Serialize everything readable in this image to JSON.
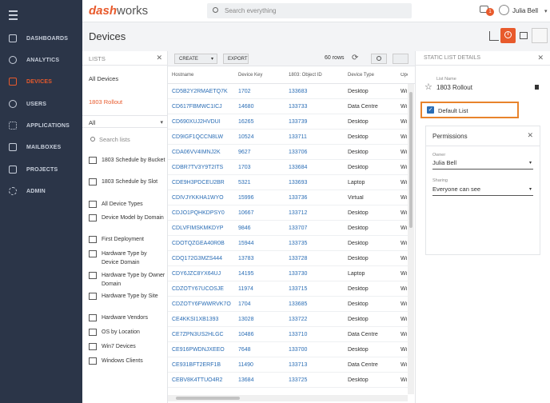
{
  "topbar": {
    "logo_part1": "dash",
    "logo_part2": "works",
    "search_placeholder": "Search everything",
    "notification_count": "1",
    "user_name": "Julia Bell"
  },
  "nav": [
    {
      "label": "DASHBOARDS",
      "icon": "dashboard-icon"
    },
    {
      "label": "ANALYTICS",
      "icon": "analytics-icon"
    },
    {
      "label": "DEVICES",
      "icon": "laptop-icon",
      "active": true
    },
    {
      "label": "USERS",
      "icon": "user-icon"
    },
    {
      "label": "APPLICATIONS",
      "icon": "grid-icon"
    },
    {
      "label": "MAILBOXES",
      "icon": "mail-icon"
    },
    {
      "label": "PROJECTS",
      "icon": "project-icon"
    },
    {
      "label": "ADMIN",
      "icon": "gear-icon"
    }
  ],
  "page": {
    "title": "Devices"
  },
  "lists_panel": {
    "header": "LISTS",
    "all_devices": "All Devices",
    "active_list": "1803 Rollout",
    "filter_value": "All",
    "search_placeholder": "Search lists",
    "entries": [
      "1803 Schedule by Bucket",
      "1803 Schedule by Slot",
      "All Device Types",
      "Device Model by Domain",
      "First Deployment",
      "Hardware Type by Device Domain",
      "Hardware Type by Owner Domain",
      "Hardware Type by Site",
      "Hardware Vendors",
      "OS by Location",
      "Win7 Devices",
      "Windows Clients"
    ]
  },
  "grid": {
    "create_label": "CREATE",
    "export_label": "EXPORT",
    "row_count": "60 rows",
    "columns": [
      "Hostname",
      "Device Key",
      "1803: Object ID",
      "Device Type",
      "Operat"
    ],
    "rows": [
      [
        "CD5B2Y2RMAETQ7K",
        "1702",
        "133683",
        "Desktop",
        "Wi"
      ],
      [
        "CD617FBMWC1ICJ",
        "14680",
        "133733",
        "Data Centre",
        "Wi"
      ],
      [
        "CD690XUJ2HVDUI",
        "16265",
        "133739",
        "Desktop",
        "Wi"
      ],
      [
        "CD9IGF1QCCN8LW",
        "10524",
        "133711",
        "Desktop",
        "Wi"
      ],
      [
        "CDA06VV4IMNJ2K",
        "9627",
        "133706",
        "Desktop",
        "Wi"
      ],
      [
        "CDBR7TV3Y9T2ITS",
        "1703",
        "133684",
        "Desktop",
        "Wi"
      ],
      [
        "CDE9H3PDCEU2BR",
        "5321",
        "133693",
        "Laptop",
        "Wi"
      ],
      [
        "CDIVJYKKHA1WYO",
        "15996",
        "133736",
        "Virtual",
        "Wi"
      ],
      [
        "CDJO1PQHKDPSY0",
        "10667",
        "133712",
        "Desktop",
        "Wi"
      ],
      [
        "CDLVFIMSKMKDYP",
        "9846",
        "133707",
        "Desktop",
        "Wi"
      ],
      [
        "CDOTQZGEA40R0B",
        "15944",
        "133735",
        "Desktop",
        "Wi"
      ],
      [
        "CDQ172G3MZS444",
        "13783",
        "133728",
        "Desktop",
        "Wi"
      ],
      [
        "CDY6JZC8YX64UJ",
        "14195",
        "133730",
        "Laptop",
        "Wi"
      ],
      [
        "CDZOTY67UCOSJE",
        "11974",
        "133715",
        "Desktop",
        "Wi"
      ],
      [
        "CDZOTY6FWWRVK7O",
        "1704",
        "133685",
        "Desktop",
        "Wi"
      ],
      [
        "CE4KKSI1XB1393",
        "13028",
        "133722",
        "Desktop",
        "Wi"
      ],
      [
        "CE7ZPN3US2HLGC",
        "10486",
        "133710",
        "Data Centre",
        "Wi"
      ],
      [
        "CE916PWDNJXEEO",
        "7648",
        "133700",
        "Desktop",
        "Wi"
      ],
      [
        "CE931BFT2ERF1B",
        "11490",
        "133713",
        "Data Centre",
        "Wi"
      ],
      [
        "CEBV8K4TTUO4R2",
        "13684",
        "133725",
        "Desktop",
        "Wi"
      ]
    ]
  },
  "details": {
    "header": "STATIC LIST DETAILS",
    "list_name_label": "List Name",
    "list_name": "1803 Rollout",
    "default_list_label": "Default List",
    "permissions_title": "Permissions",
    "owner_label": "Owner",
    "owner_value": "Julia Bell",
    "sharing_label": "Sharing",
    "sharing_value": "Everyone can see"
  }
}
